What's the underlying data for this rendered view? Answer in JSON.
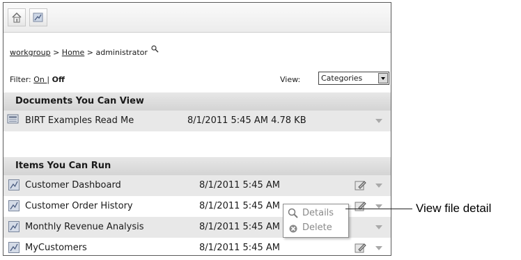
{
  "toolbar": {
    "home_icon": "home-icon",
    "report_icon": "report-icon"
  },
  "breadcrumb": {
    "workgroup": "workgroup",
    "sep1": " > ",
    "home": "Home",
    "sep2": " > administrator",
    "search_icon": "magnifier-icon"
  },
  "filter": {
    "label": "Filter: ",
    "on": "On ",
    "sep": "| ",
    "off": "Off"
  },
  "view": {
    "label": "View:",
    "selected": "Categories"
  },
  "documents": {
    "header": "Documents You Can View",
    "items": [
      {
        "name": "BIRT Examples Read Me",
        "date": "8/1/2011 5:45 AM 4.78 KB"
      }
    ]
  },
  "runnable": {
    "header": "Items You Can Run",
    "items": [
      {
        "name": "Customer Dashboard",
        "date": "8/1/2011 5:45 AM"
      },
      {
        "name": "Customer Order History",
        "date": "8/1/2011 5:45 AM"
      },
      {
        "name": "Monthly Revenue Analysis",
        "date": "8/1/2011 5:45 AM"
      },
      {
        "name": "MyCustomers",
        "date": "8/1/2011 5:45 AM"
      }
    ]
  },
  "context_menu": {
    "details": "Details",
    "delete": "Delete"
  },
  "callout": "View file detail"
}
